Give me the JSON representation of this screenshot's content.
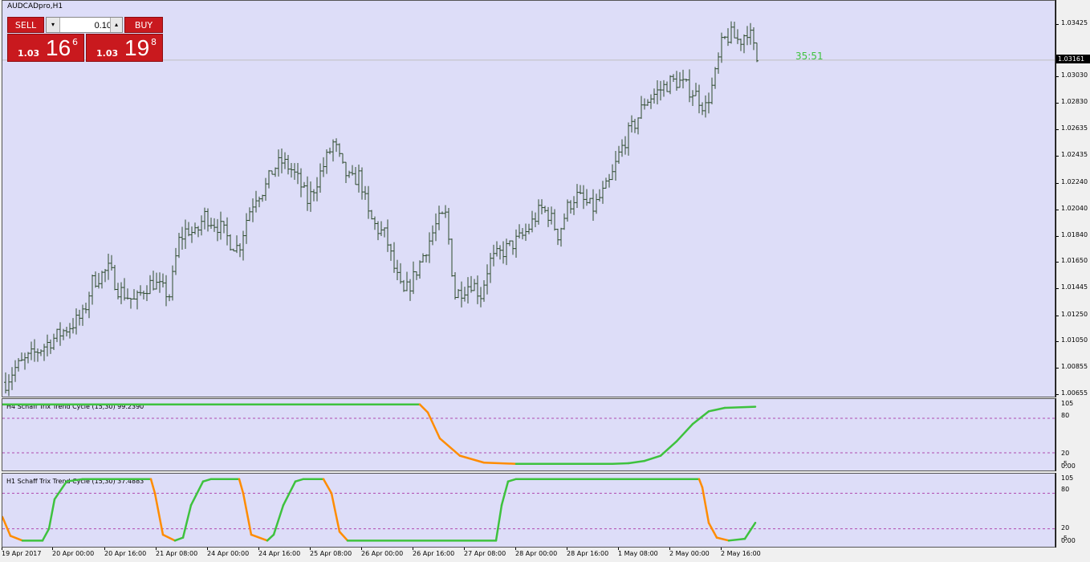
{
  "window": {
    "title": "AUDCADpro,H1"
  },
  "trade_panel": {
    "sell_label": "SELL",
    "buy_label": "BUY",
    "lot_value": "0.10",
    "sell_price_small": "1.03",
    "sell_price_big": "16",
    "sell_price_sup": "6",
    "buy_price_small": "1.03",
    "buy_price_big": "19",
    "buy_price_sup": "8"
  },
  "countdown": "35:51",
  "current_price": "1.03161",
  "colors": {
    "background": "#ddddf8",
    "bars": "#2d4a2d",
    "up_line": "#3ec23e",
    "down_line": "#ff8c00",
    "level_line": "#b04ab0"
  },
  "price_axis": {
    "ticks": [
      "1.03425",
      "1.03030",
      "1.02830",
      "1.02635",
      "1.02435",
      "1.02240",
      "1.02040",
      "1.01840",
      "1.01650",
      "1.01445",
      "1.01250",
      "1.01050",
      "1.00855",
      "1.00655"
    ]
  },
  "indicator_h4": {
    "title": "H4 Schaff Trix Trend Cycle (15,30) 99.2390",
    "levels": [
      "105",
      "80",
      "20",
      "-5"
    ],
    "level_extra": "0.00"
  },
  "indicator_h1": {
    "title": "H1 Schaff Trix Trend Cycle (15,30) 37.4883",
    "levels": [
      "105",
      "80",
      "20",
      "-5"
    ],
    "level_extra": "0.00"
  },
  "time_axis": {
    "ticks": [
      "19 Apr 2017",
      "20 Apr 00:00",
      "20 Apr 16:00",
      "21 Apr 08:00",
      "24 Apr 00:00",
      "24 Apr 16:00",
      "25 Apr 08:00",
      "26 Apr 00:00",
      "26 Apr 16:00",
      "27 Apr 08:00",
      "28 Apr 00:00",
      "28 Apr 16:00",
      "1 May 08:00",
      "2 May 00:00",
      "2 May 16:00"
    ]
  },
  "chart_data": {
    "type": "ohlc",
    "symbol": "AUDCADpro",
    "timeframe": "H1",
    "ylim": [
      1.00655,
      1.03425
    ],
    "close_trend": [
      1.0075,
      1.0085,
      1.009,
      1.0095,
      1.01,
      1.0105,
      1.011,
      1.0115,
      1.012,
      1.0125,
      1.015,
      1.0155,
      1.016,
      1.0145,
      1.014,
      1.0135,
      1.0145,
      1.015,
      1.0145,
      1.014,
      1.018,
      1.019,
      1.0185,
      1.02,
      1.0195,
      1.019,
      1.018,
      1.0175,
      1.02,
      1.0215,
      1.022,
      1.0235,
      1.024,
      1.0235,
      1.0225,
      1.021,
      1.0225,
      1.024,
      1.0255,
      1.0235,
      1.0225,
      1.023,
      1.02,
      1.019,
      1.0185,
      1.016,
      1.014,
      1.015,
      1.0165,
      1.018,
      1.0195,
      1.02,
      1.014,
      1.0145,
      1.015,
      1.014,
      1.0165,
      1.017,
      1.0175,
      1.018,
      1.0185,
      1.0195,
      1.0205,
      1.02,
      1.0185,
      1.0205,
      1.0215,
      1.021,
      1.0205,
      1.0215,
      1.0225,
      1.0245,
      1.026,
      1.027,
      1.0285,
      1.029,
      1.0295,
      1.03,
      1.03,
      1.0295,
      1.029,
      1.028,
      1.03,
      1.033,
      1.0335,
      1.033,
      1.034,
      1.0316
    ]
  }
}
